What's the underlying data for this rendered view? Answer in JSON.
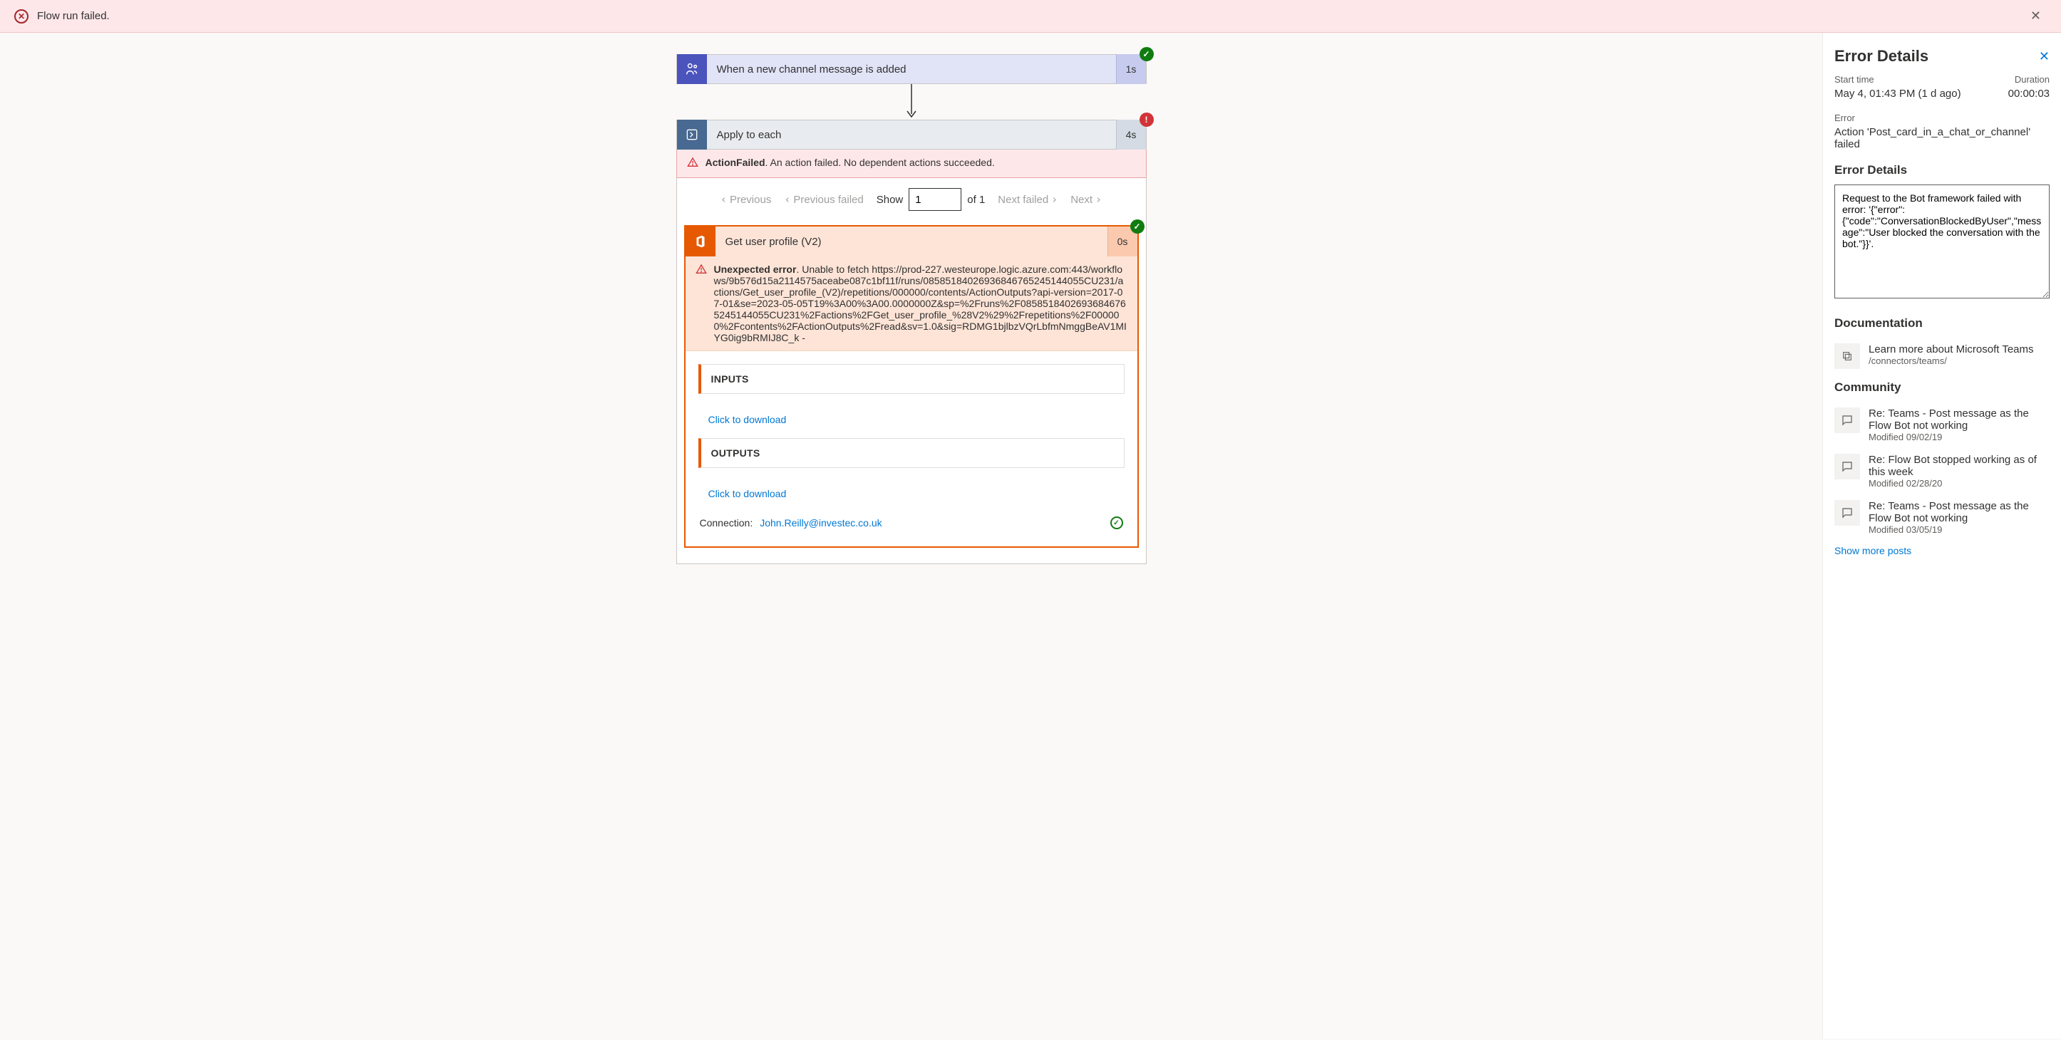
{
  "banner": {
    "text": "Flow run failed."
  },
  "trigger": {
    "title": "When a new channel message is added",
    "duration": "1s"
  },
  "apply": {
    "title": "Apply to each",
    "duration": "4s",
    "error_label": "ActionFailed",
    "error_text": ". An action failed. No dependent actions succeeded."
  },
  "pager": {
    "previous": "Previous",
    "previous_failed": "Previous failed",
    "show_label": "Show",
    "current": "1",
    "of_label": "of 1",
    "next_failed": "Next failed",
    "next": "Next"
  },
  "inner": {
    "title": "Get user profile (V2)",
    "duration": "0s",
    "error_label": "Unexpected error",
    "error_text": ". Unable to fetch https://prod-227.westeurope.logic.azure.com:443/workflows/9b576d15a2114575aceabe087c1bf11f/runs/08585184026936846765245144055CU231/actions/Get_user_profile_(V2)/repetitions/000000/contents/ActionOutputs?api-version=2017-07-01&se=2023-05-05T19%3A00%3A00.0000000Z&sp=%2Fruns%2F08585184026936846765245144055CU231%2Factions%2FGet_user_profile_%28V2%29%2Frepetitions%2F000000%2Fcontents%2FActionOutputs%2Fread&sv=1.0&sig=RDMG1bjlbzVQrLbfmNmggBeAV1MIYG0ig9bRMIJ8C_k -",
    "inputs_label": "INPUTS",
    "outputs_label": "OUTPUTS",
    "download_link": "Click to download",
    "connection_label": "Connection:",
    "connection_value": "John.Reilly@investec.co.uk"
  },
  "sidebar": {
    "title": "Error Details",
    "start_label": "Start time",
    "duration_label": "Duration",
    "start_value": "May 4, 01:43 PM (1 d ago)",
    "duration_value": "00:00:03",
    "error_label": "Error",
    "error_summary": "Action 'Post_card_in_a_chat_or_channel' failed",
    "details_label": "Error Details",
    "details_text": "Request to the Bot framework failed with error: '{\"error\":{\"code\":\"ConversationBlockedByUser\",\"message\":\"User blocked the conversation with the bot.\"}}'.",
    "documentation_label": "Documentation",
    "doc_item_title": "Learn more about Microsoft Teams",
    "doc_item_sub": "/connectors/teams/",
    "community_label": "Community",
    "community": [
      {
        "title": "Re: Teams - Post message as the Flow Bot not working",
        "sub": "Modified 09/02/19"
      },
      {
        "title": "Re: Flow Bot stopped working as of this week",
        "sub": "Modified 02/28/20"
      },
      {
        "title": "Re: Teams - Post message as the Flow Bot not working",
        "sub": "Modified 03/05/19"
      }
    ],
    "show_more": "Show more posts"
  }
}
